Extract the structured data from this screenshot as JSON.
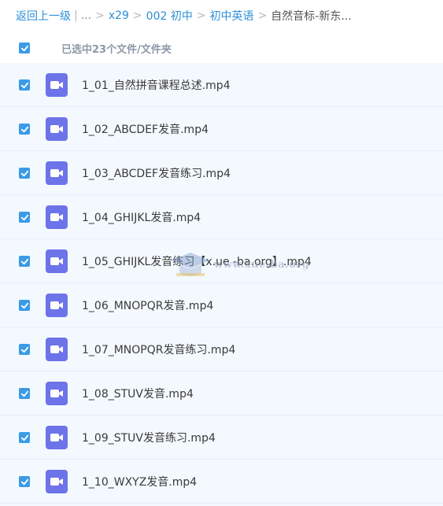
{
  "breadcrumb": {
    "back": "返回上一级",
    "divider": "|",
    "ellipsis": "...",
    "sep": ">",
    "items": [
      "x29",
      "002 初中",
      "初中英语"
    ],
    "current": "自然音标-新东..."
  },
  "selection": {
    "text": "已选中23个文件/文件夹",
    "checked": true
  },
  "files": [
    {
      "name": "1_01_自然拼音课程总述.mp4",
      "checked": true,
      "icon": "video-file-icon"
    },
    {
      "name": "1_02_ABCDEF发音.mp4",
      "checked": true,
      "icon": "video-file-icon"
    },
    {
      "name": "1_03_ABCDEF发音练习.mp4",
      "checked": true,
      "icon": "video-file-icon"
    },
    {
      "name": "1_04_GHIJKL发音.mp4",
      "checked": true,
      "icon": "video-file-icon"
    },
    {
      "name": "1_05_GHIJKL发音练习【x.ue -ba.org】.mp4",
      "checked": true,
      "icon": "video-file-icon"
    },
    {
      "name": "1_06_MNOPQR发音.mp4",
      "checked": true,
      "icon": "video-file-icon"
    },
    {
      "name": "1_07_MNOPQR发音练习.mp4",
      "checked": true,
      "icon": "video-file-icon"
    },
    {
      "name": "1_08_STUV发音.mp4",
      "checked": true,
      "icon": "video-file-icon"
    },
    {
      "name": "1_09_STUV发音练习.mp4",
      "checked": true,
      "icon": "video-file-icon"
    },
    {
      "name": "1_10_WXYZ发音.mp4",
      "checked": true,
      "icon": "video-file-icon"
    }
  ],
  "watermark": {
    "text": "www.xue-ba.org"
  },
  "colors": {
    "link": "#2a8fd8",
    "checkbox": "#3a9be6",
    "file_icon": "#6d73e8",
    "list_bg": "#f3f9fe"
  }
}
